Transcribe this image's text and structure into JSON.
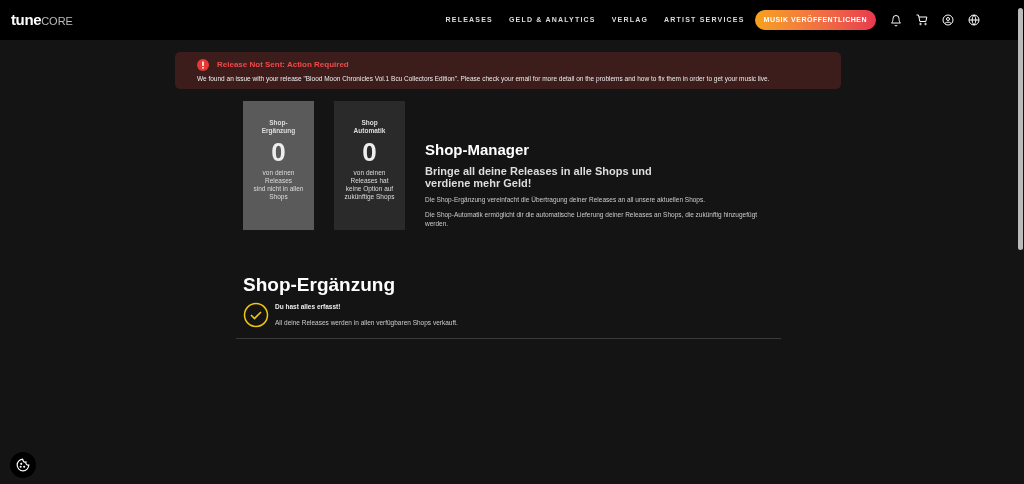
{
  "header": {
    "logo": {
      "part_1": "tune",
      "part_2": "CORE"
    },
    "nav": [
      "RELEASES",
      "GELD & ANALYTICS",
      "VERLAG",
      "ARTIST SERVICES"
    ],
    "cta": "MUSIK VERÖFFENTLICHEN"
  },
  "alert": {
    "title": "Release Not Sent: Action Required",
    "message": "We found an issue with your release \"Blood Moon Chronicles Vol.1 Bcu Collectors Edition\". Please check your email for more detail on the problems and how to fix them in order to get your music live."
  },
  "cards": [
    {
      "title": "Shop-Ergänzung",
      "count": "0",
      "lines": [
        "von deinen",
        "Releases",
        "sind nicht in allen",
        "Shops"
      ],
      "selected": true
    },
    {
      "title": "Shop Automatik",
      "count": "0",
      "lines": [
        "von deinen",
        "Releases hat",
        "keine Option auf",
        "zukünftige Shops"
      ],
      "selected": false
    }
  ],
  "manager": {
    "title": "Shop-Manager",
    "subtitle": "Bringe all deine Releases in alle Shops und verdiene mehr Geld!",
    "paragraphs": [
      "Die Shop-Ergänzung vereinfacht die Übertragung deiner Releases an all unsere aktuellen Shops.",
      "Die Shop-Automatik ermöglicht dir die automatische Lieferung deiner Releases an Shops, die zukünftig hinzugefügt werden."
    ]
  },
  "section": {
    "title": "Shop-Ergänzung",
    "status_title": "Du hast alles erfasst!",
    "status_text": "All deine Releases werden in allen verfügbaren Shops verkauft."
  }
}
